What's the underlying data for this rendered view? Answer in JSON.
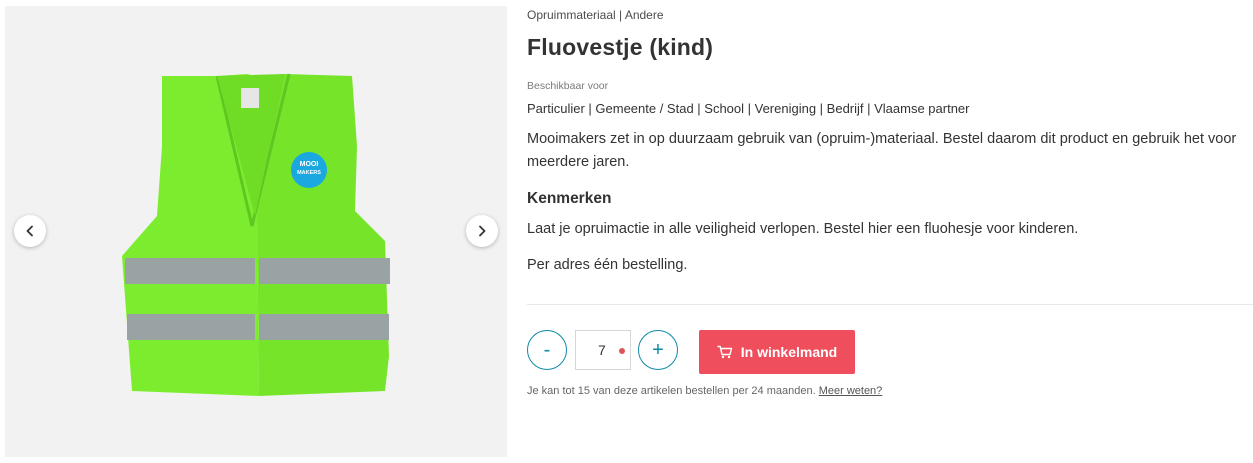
{
  "gallery": {
    "image_alt": "Fluovestje (kind)",
    "badge_line_1": "MOOI",
    "badge_line_2": "MAKERS",
    "prev_icon": "chevron-left-icon",
    "next_icon": "chevron-right-icon"
  },
  "product": {
    "breadcrumb": "Opruimmateriaal | Andere",
    "title": "Fluovestje (kind)",
    "availability_label": "Beschikbaar voor",
    "availability_values": "Particulier | Gemeente / Stad | School | Vereniging | Bedrijf | Vlaamse partner",
    "intro": "Mooimakers zet in op duurzaam gebruik van (opruim-)materiaal. Bestel daarom dit product en gebruik het voor meerdere jaren.",
    "features_heading": "Kenmerken",
    "feature_text_1": "Laat je opruimactie in alle veiligheid verlopen. Bestel hier een fluohesje voor kinderen.",
    "feature_text_2": "Per adres één bestelling."
  },
  "order": {
    "minus_label": "-",
    "plus_label": "+",
    "quantity": "7",
    "cart_label": "In winkelmand",
    "cart_icon": "cart-icon",
    "limit_note": "Je kan tot 15 van deze artikelen bestellen per 24 maanden.",
    "limit_link": "Meer weten?"
  },
  "colors": {
    "vest": "#7ced2e",
    "reflective_strip": "#9aa3a3",
    "badge": "#1ba7e0",
    "stepper": "#0d8aa6",
    "cart_button": "#ef4f5d",
    "gallery_background": "#f2f2f2"
  }
}
